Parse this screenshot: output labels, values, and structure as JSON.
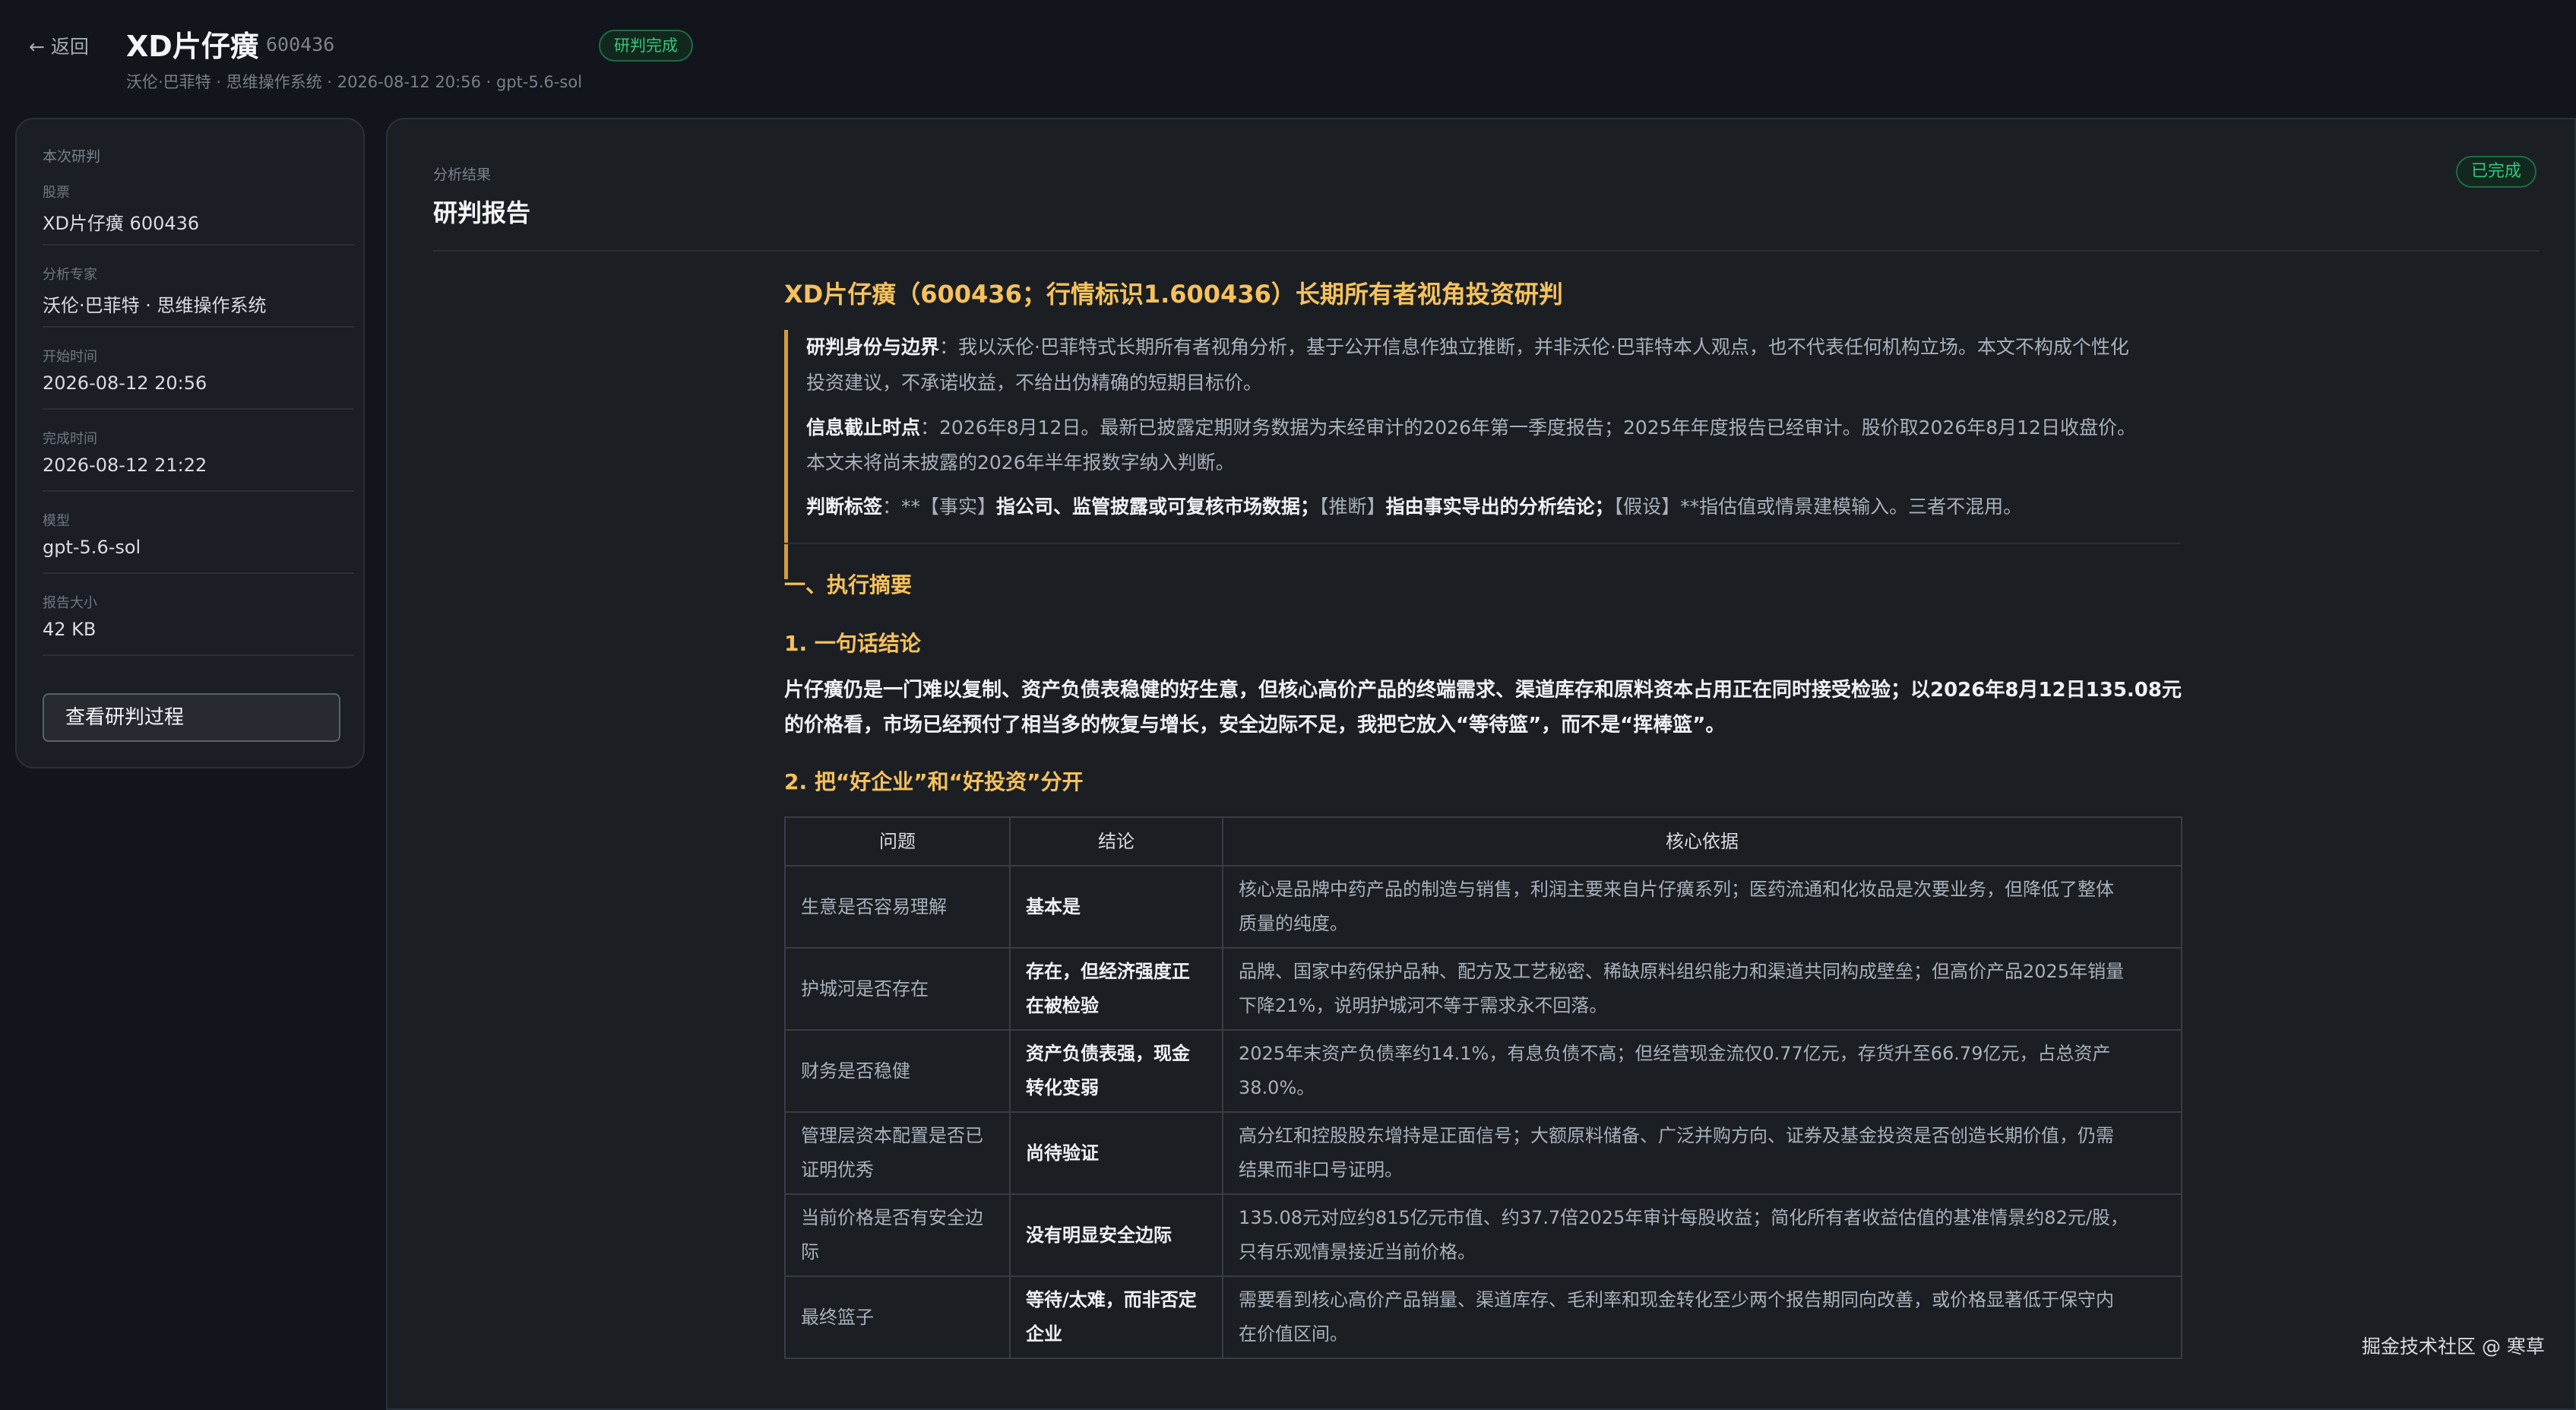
{
  "header": {
    "back_label": "← 返回",
    "title": "XD片仔癀",
    "code": "600436",
    "status_badge": "研判完成",
    "meta": "沃伦·巴菲特 · 思维操作系统 · 2026-08-12 20:56 · gpt-5.6-sol"
  },
  "sidebar": {
    "title": "本次研判",
    "fields": [
      {
        "label": "股票",
        "value": "XD片仔癀 600436"
      },
      {
        "label": "分析专家",
        "value": "沃伦·巴菲特 · 思维操作系统"
      },
      {
        "label": "开始时间",
        "value": "2026-08-12 20:56"
      },
      {
        "label": "完成时间",
        "value": "2026-08-12 21:22"
      },
      {
        "label": "模型",
        "value": "gpt-5.6-sol"
      },
      {
        "label": "报告大小",
        "value": "42 KB"
      }
    ],
    "button_label": "查看研判过程"
  },
  "main": {
    "section_label": "分析结果",
    "section_title": "研判报告",
    "status_badge": "已完成"
  },
  "report": {
    "title": "XD片仔癀（600436；行情标识1.600436）长期所有者视角投资研判",
    "quote": [
      {
        "label": "研判身份与边界",
        "text": "：我以沃伦·巴菲特式长期所有者视角分析，基于公开信息作独立推断，并非沃伦·巴菲特本人观点，也不代表任何机构立场。本文不构成个性化"
      },
      {
        "text": "投资建议，不承诺收益，不给出伪精确的短期目标价。"
      },
      {
        "label": "信息截止时点",
        "text": "：2026年8月12日。最新已披露定期财务数据为未经审计的2026年第一季度报告；2025年年度报告已经审计。股价取2026年8月12日收盘价。"
      },
      {
        "text": "本文未将尚未披露的2026年半年报数字纳入判断。"
      },
      {
        "label": "判断标签",
        "text_pre": "：**【事实】",
        "text_b1": "指公司、监管披露或可复核市场数据；",
        "text_mid": "【推断】",
        "text_b2": "指由事实导出的分析结论；",
        "text_post": "【假设】**指估值或情景建模输入。三者不混用。"
      }
    ],
    "section1": "一、执行摘要",
    "sub1": "1. 一句话结论",
    "summary_lines": [
      "片仔癀仍是一门难以复制、资产负债表稳健的好生意，但核心高价产品的终端需求、渠道库存和原料资本占用正在同时接受检验；以2026年8月12日135.08元",
      "的价格看，市场已经预付了相当多的恢复与增长，安全边际不足，我把它放入“等待篮”，而不是“挥棒篮”。"
    ],
    "sub2": "2. 把“好企业”和“好投资”分开",
    "table": {
      "headers": [
        "问题",
        "结论",
        "核心依据"
      ],
      "rows": [
        {
          "q": [
            "生意是否容易理解"
          ],
          "c": [
            "基本是"
          ],
          "e": [
            "核心是品牌中药产品的制造与销售，利润主要来自片仔癀系列；医药流通和化妆品是次要业务，但降低了整体",
            "质量的纯度。"
          ]
        },
        {
          "q": [
            "护城河是否存在"
          ],
          "c": [
            "存在，但经济强度正",
            "在被检验"
          ],
          "e": [
            "品牌、国家中药保护品种、配方及工艺秘密、稀缺原料组织能力和渠道共同构成壁垒；但高价产品2025年销量",
            "下降21%，说明护城河不等于需求永不回落。"
          ]
        },
        {
          "q": [
            "财务是否稳健"
          ],
          "c": [
            "资产负债表强，现金",
            "转化变弱"
          ],
          "e": [
            "2025年末资产负债率约14.1%，有息负债不高；但经营现金流仅0.77亿元，存货升至66.79亿元，占总资产",
            "38.0%。"
          ]
        },
        {
          "q": [
            "管理层资本配置是否已",
            "证明优秀"
          ],
          "c": [
            "尚待验证"
          ],
          "e": [
            "高分红和控股股东增持是正面信号；大额原料储备、广泛并购方向、证券及基金投资是否创造长期价值，仍需",
            "结果而非口号证明。"
          ]
        },
        {
          "q": [
            "当前价格是否有安全边",
            "际"
          ],
          "c": [
            "没有明显安全边际"
          ],
          "e": [
            "135.08元对应约815亿元市值、约37.7倍2025年审计每股收益；简化所有者收益估值的基准情景约82元/股，",
            "只有乐观情景接近当前价格。"
          ]
        },
        {
          "q": [
            "最终篮子"
          ],
          "c": [
            "等待/太难，而非否定",
            "企业"
          ],
          "e": [
            "需要看到核心高价产品销量、渠道库存、毛利率和现金转化至少两个报告期同向改善，或价格显著低于保守内",
            "在价值区间。"
          ]
        }
      ]
    }
  },
  "watermark": "掘金技术社区 @ 寒草"
}
